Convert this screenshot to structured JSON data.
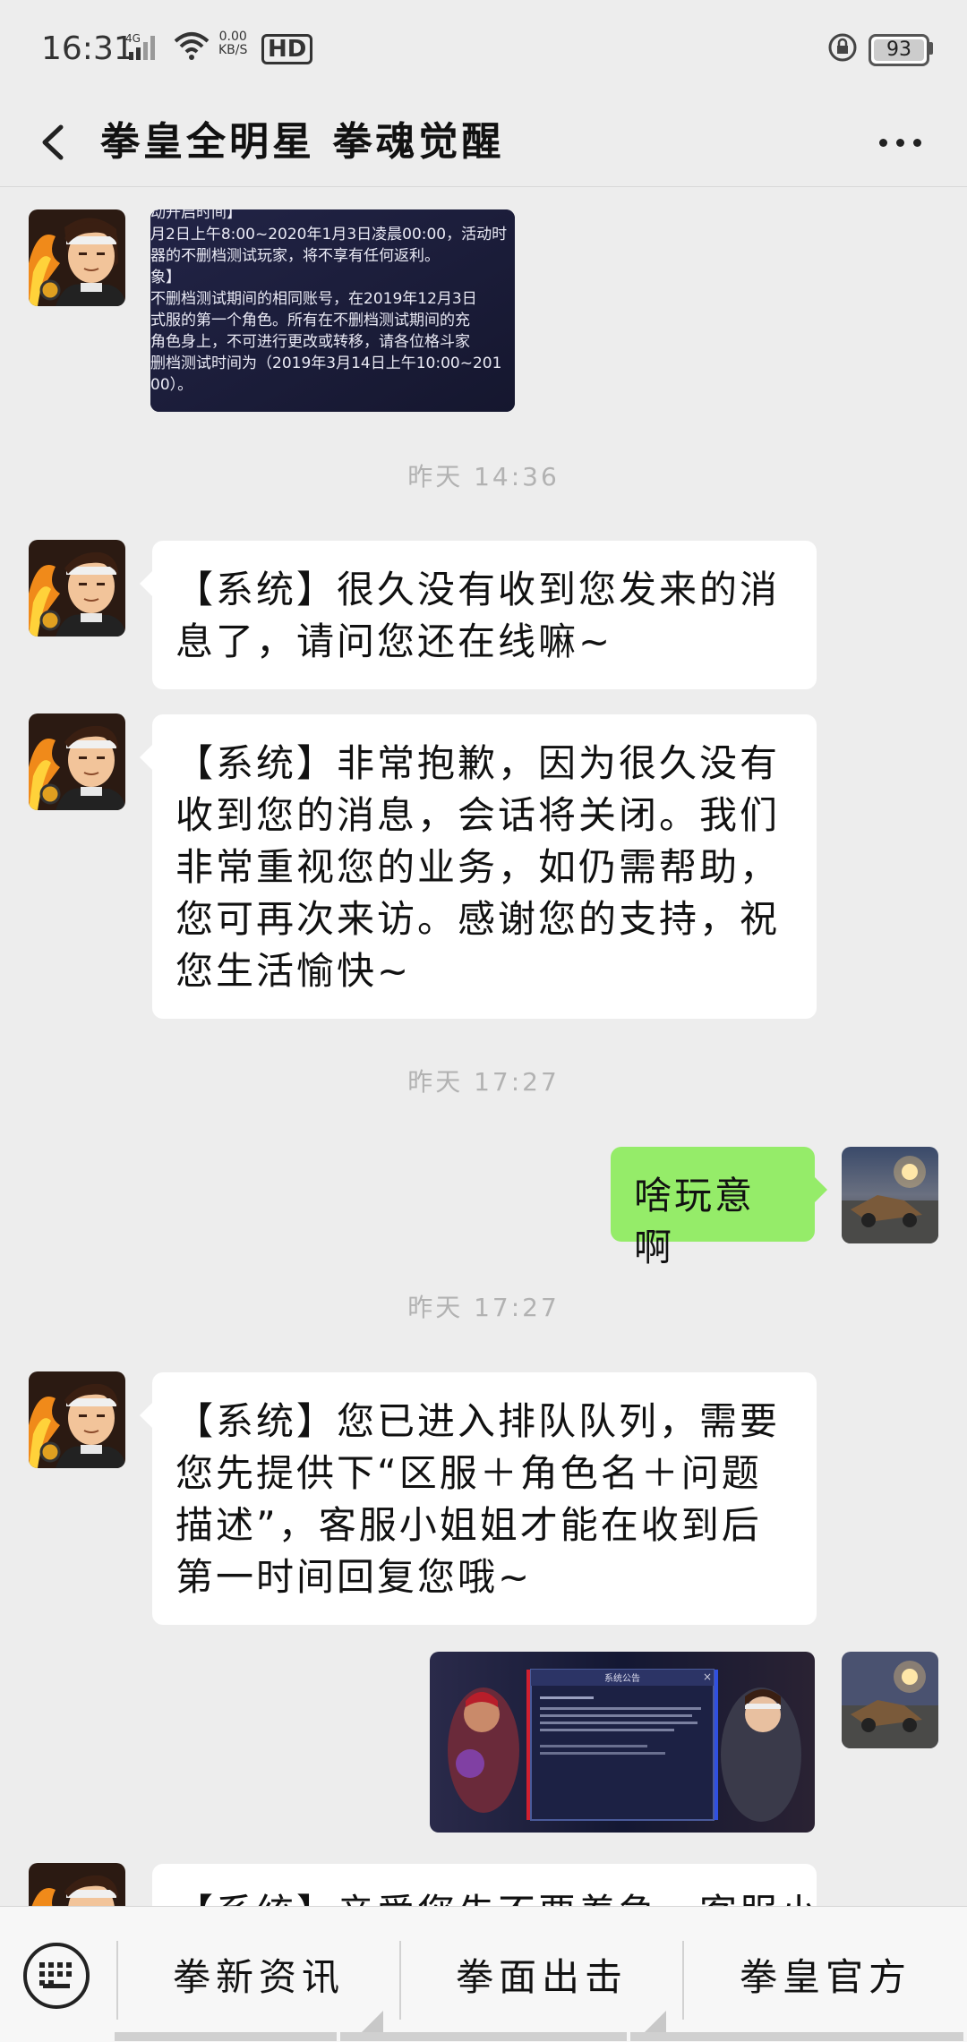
{
  "status_bar": {
    "time": "16:31",
    "network": "4G",
    "speed_value": "0.00",
    "speed_unit": "KB/S",
    "hd": "HD",
    "battery": "93"
  },
  "header": {
    "title": "拳皇全明星 拳魂觉醒"
  },
  "messages": {
    "notice_image_text": [
      "动开启时间】",
      "月2日上午8:00~2020年1月3日凌晨00:00，活动时",
      "器的不删档测试玩家，将不享有任何返利。",
      "象】",
      "不删档测试期间的相同账号，在2019年12月3日",
      "式服的第一个角色。所有在不删档测试期间的充",
      "角色身上，不可进行更改或转移，请各位格斗家",
      "删档测试时间为（2019年3月14日上午10:00~201",
      "00）。"
    ],
    "ts1": "昨天 14:36",
    "msg1": "【系统】很久没有收到您发来的消息了，请问您还在线嘛~",
    "msg2": "【系统】非常抱歉，因为很久没有收到您的消息，会话将关闭。我们非常重视您的业务，如仍需帮助，您可再次来访。感谢您的支持，祝您生活愉快~",
    "ts2": "昨天 17:27",
    "msg3": "啥玩意啊",
    "ts3": "昨天 17:27",
    "msg4": "【系统】您已进入排队队列，需要您先提供下“区服＋角色名＋问题描述”，客服小姐姐才能在收到后第一时间回复您哦~",
    "game_screenshot_title": "系统公告",
    "msg5_partial": "【系统】亲爱您先不要着急，客服小"
  },
  "bottom_menu": {
    "items": [
      "拳新资讯",
      "拳面出击",
      "拳皇官方"
    ]
  },
  "icons": {
    "back": "chevron-left-icon",
    "more": "more-dots-icon",
    "keyboard": "keyboard-icon"
  }
}
